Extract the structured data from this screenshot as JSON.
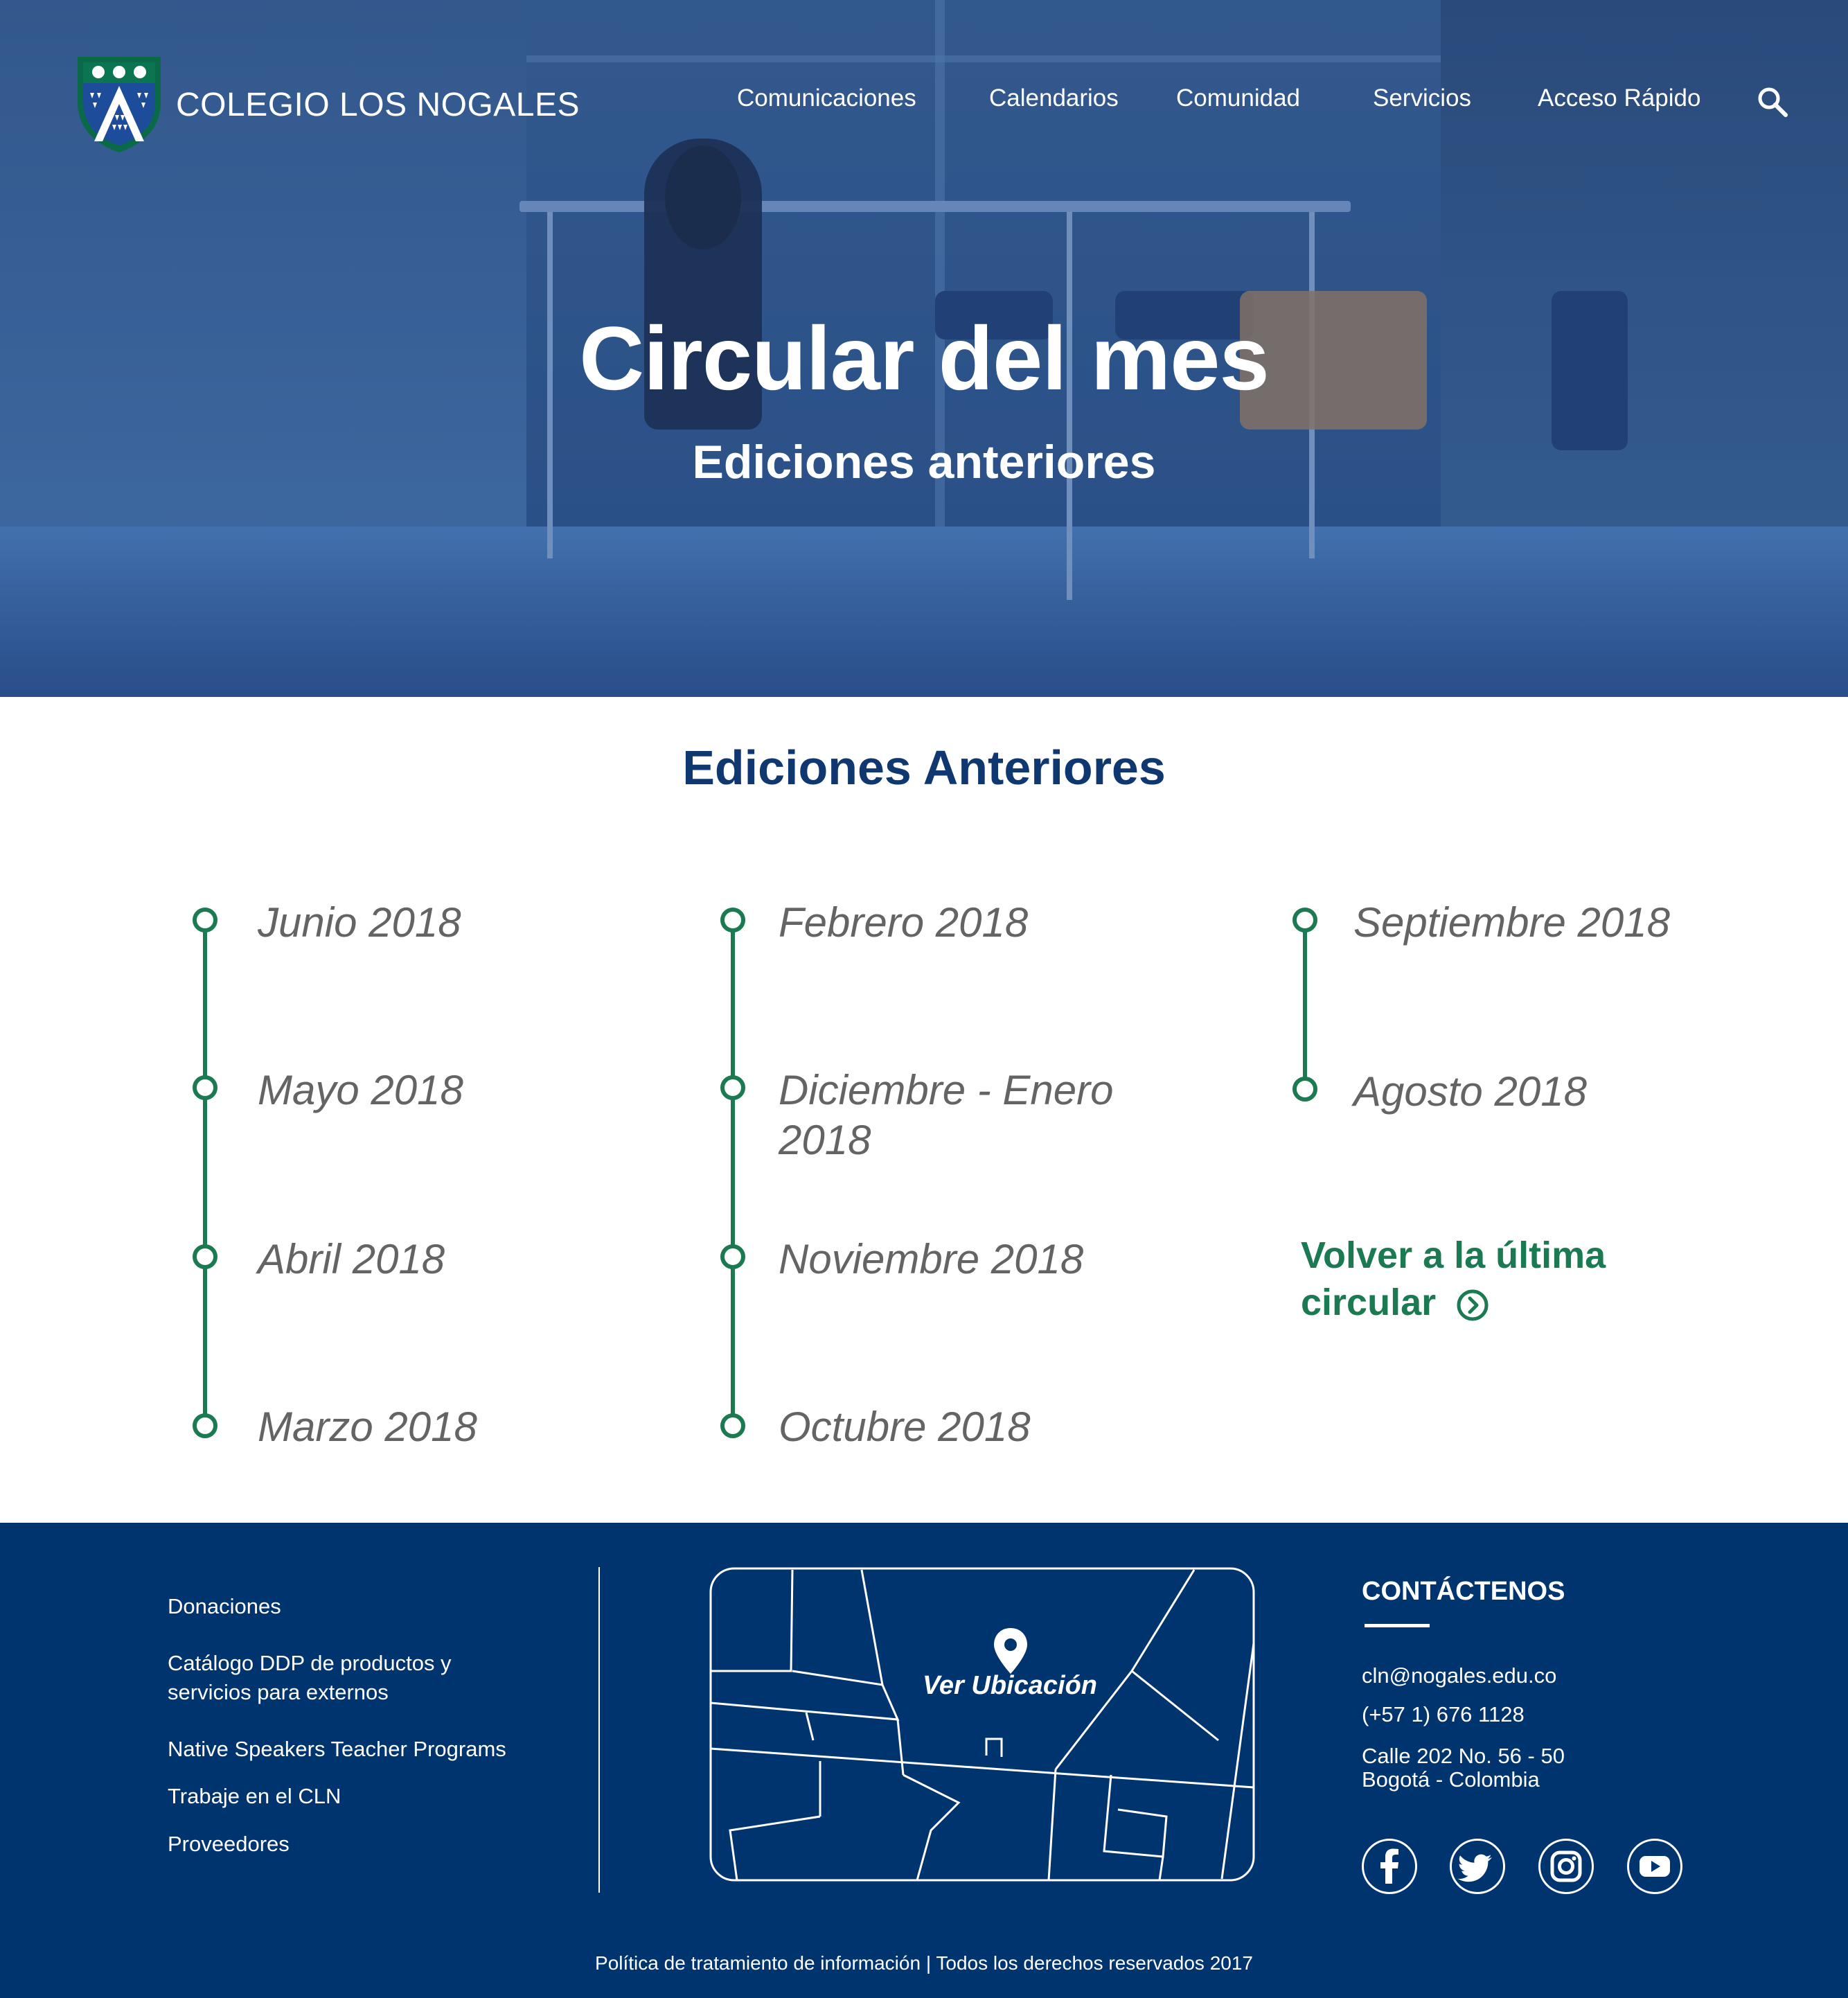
{
  "header": {
    "brand": "COLEGIO LOS NOGALES",
    "nav": [
      {
        "label": "Comunicaciones"
      },
      {
        "label": "Calendarios"
      },
      {
        "label": "Comunidad"
      },
      {
        "label": "Servicios"
      },
      {
        "label": "Acceso Rápido"
      }
    ],
    "search_icon": "search-icon"
  },
  "hero": {
    "title": "Circular del mes",
    "subtitle": "Ediciones anteriores"
  },
  "main": {
    "section_title": "Ediciones Anteriores",
    "columns": [
      {
        "items": [
          "Junio 2018",
          "Mayo 2018",
          "Abril 2018",
          "Marzo 2018"
        ]
      },
      {
        "items": [
          "Febrero 2018",
          "Diciembre - Enero 2018",
          "Noviembre 2018",
          "Octubre 2018"
        ]
      },
      {
        "items": [
          "Septiembre 2018",
          "Agosto 2018"
        ]
      }
    ],
    "back_link": "Volver a la última circular",
    "back_icon": "chevron-right-circle-icon"
  },
  "footer": {
    "links": [
      "Donaciones",
      "Catálogo DDP de productos y servicios para externos",
      "Native Speakers Teacher Programs",
      "Trabaje en el CLN",
      "Proveedores"
    ],
    "map_label": "Ver Ubicación",
    "contact": {
      "title": "CONTÁCTENOS",
      "email": "cln@nogales.edu.co",
      "phone": "(+57 1) 676 1128",
      "address_line1": "Calle 202 No. 56 - 50",
      "address_line2": "Bogotá - Colombia"
    },
    "social": [
      "facebook-icon",
      "twitter-icon",
      "instagram-icon",
      "youtube-icon"
    ],
    "copyright": "Política de tratamiento de información | Todos los derechos reservados 2017"
  },
  "colors": {
    "navy": "#00346e",
    "title_blue": "#0f3870",
    "green": "#1b7a52",
    "gray_text": "#646464"
  }
}
